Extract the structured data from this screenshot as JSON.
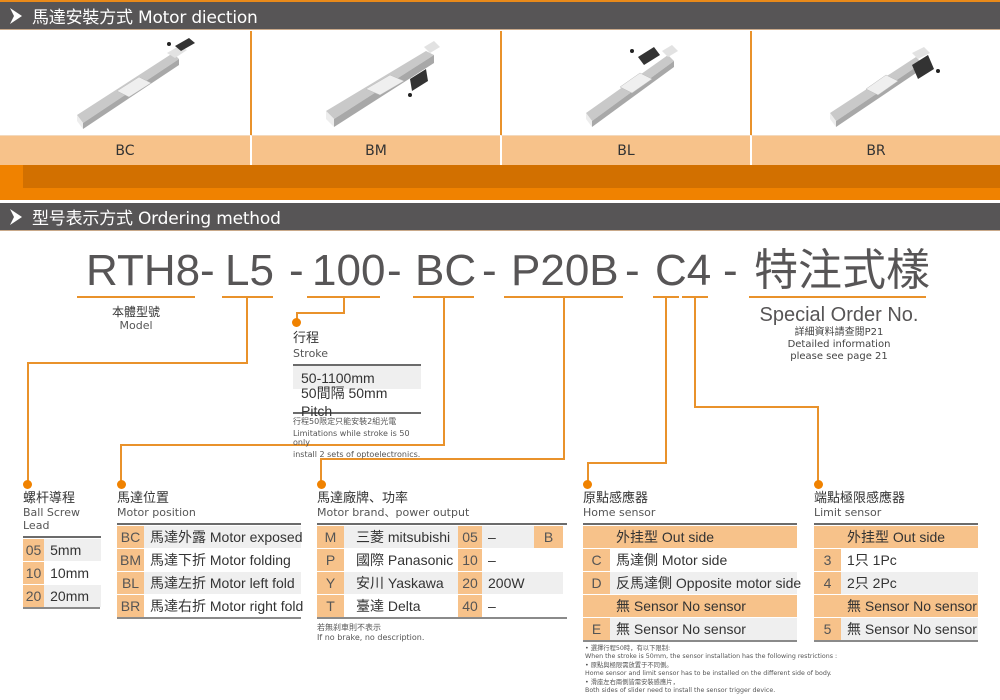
{
  "motor_direction": {
    "title": "馬達安裝方式 Motor diection",
    "icon": "chevron-right-icon",
    "options": [
      {
        "code": "BC",
        "image": "linear-module-motor-exposed"
      },
      {
        "code": "BM",
        "image": "linear-module-motor-folding-down"
      },
      {
        "code": "BL",
        "image": "linear-module-motor-left-fold"
      },
      {
        "code": "BR",
        "image": "linear-module-motor-right-fold"
      }
    ]
  },
  "ordering": {
    "title": "型号表示方式  Ordering method",
    "icon": "chevron-right-icon",
    "code_segments": [
      "RTH8",
      "-",
      "L5",
      "-",
      "100",
      "-",
      "BC",
      "-",
      "P20B",
      "-",
      "C4",
      "-",
      "特注式樣"
    ],
    "model_label": {
      "cn": "本體型號",
      "en": "Model"
    },
    "special": {
      "title": "Special Order No.",
      "cn": "詳細資料請查閱P21",
      "en1": "Detailed information",
      "en2": "please see page 21"
    },
    "stroke": {
      "cn": "行程",
      "en": "Stroke",
      "rows": [
        "50-1100mm",
        "50間隔 50mm Pitch"
      ],
      "note_cn": "行程50限定只能安裝2組光電",
      "note_en1": "Limitations while stroke is 50 only",
      "note_en2": "install 2 sets of optoelectronics."
    },
    "lead": {
      "cn": "螺杆導程",
      "en": "Ball Screw Lead",
      "rows": [
        {
          "code": "05",
          "value": "5mm"
        },
        {
          "code": "10",
          "value": "10mm"
        },
        {
          "code": "20",
          "value": "20mm"
        }
      ]
    },
    "motor_position": {
      "cn": "馬達位置",
      "en": "Motor position",
      "rows": [
        {
          "code": "BC",
          "value": "馬達外露 Motor exposed"
        },
        {
          "code": "BM",
          "value": "馬達下折 Motor folding"
        },
        {
          "code": "BL",
          "value": "馬達左折 Motor left fold"
        },
        {
          "code": "BR",
          "value": "馬達右折 Motor right fold"
        }
      ]
    },
    "motor_brand": {
      "cn": "馬達廠牌、功率",
      "en": "Motor brand、power output",
      "rows": [
        {
          "code": "M",
          "brand": "三菱 mitsubishi",
          "power_code": "05",
          "power": "–",
          "brake": "B"
        },
        {
          "code": "P",
          "brand": "國際 Panasonic",
          "power_code": "10",
          "power": "–",
          "brake": ""
        },
        {
          "code": "Y",
          "brand": "安川 Yaskawa",
          "power_code": "20",
          "power": "200W",
          "brake": ""
        },
        {
          "code": "T",
          "brand": "臺達 Delta",
          "power_code": "40",
          "power": "–",
          "brake": ""
        }
      ],
      "note_cn": "若無刹車則不表示",
      "note_en": "If no brake, no description."
    },
    "home_sensor": {
      "cn": "原點感應器",
      "en": "Home sensor",
      "rows": [
        {
          "code": "",
          "value": "外挂型 Out side",
          "style": "orange"
        },
        {
          "code": "C",
          "value": "馬達側 Motor side",
          "style": "white"
        },
        {
          "code": "D",
          "value": "反馬達側 Opposite motor side",
          "style": "grey"
        },
        {
          "code": "",
          "value": "無 Sensor No sensor",
          "style": "orange"
        },
        {
          "code": "E",
          "value": "無 Sensor No sensor",
          "style": "grey"
        }
      ]
    },
    "limit_sensor": {
      "cn": "端點極限感應器",
      "en": "Limit sensor",
      "rows": [
        {
          "code": "",
          "value": "外挂型 Out side",
          "style": "orange"
        },
        {
          "code": "3",
          "value": "1只 1Pc",
          "style": "white"
        },
        {
          "code": "4",
          "value": "2只 2Pc",
          "style": "grey"
        },
        {
          "code": "",
          "value": "無 Sensor No sensor",
          "style": "orange"
        },
        {
          "code": "5",
          "value": "無 Sensor No sensor",
          "style": "grey"
        }
      ]
    },
    "notes": [
      {
        "cn": "• 選擇行程50時，有以下限制:",
        "en": "When the stroke is 50mm,  the sensor installation has the following restrictions :"
      },
      {
        "cn": "• 原點與極限需放置于不同側。",
        "en": "Home sensor and limit sensor has to be installed on the different side of body."
      },
      {
        "cn": "• 滑座左右兩側皆需安裝感應片，",
        "en": "Both sides of slider need to install the sensor trigger device."
      }
    ]
  }
}
